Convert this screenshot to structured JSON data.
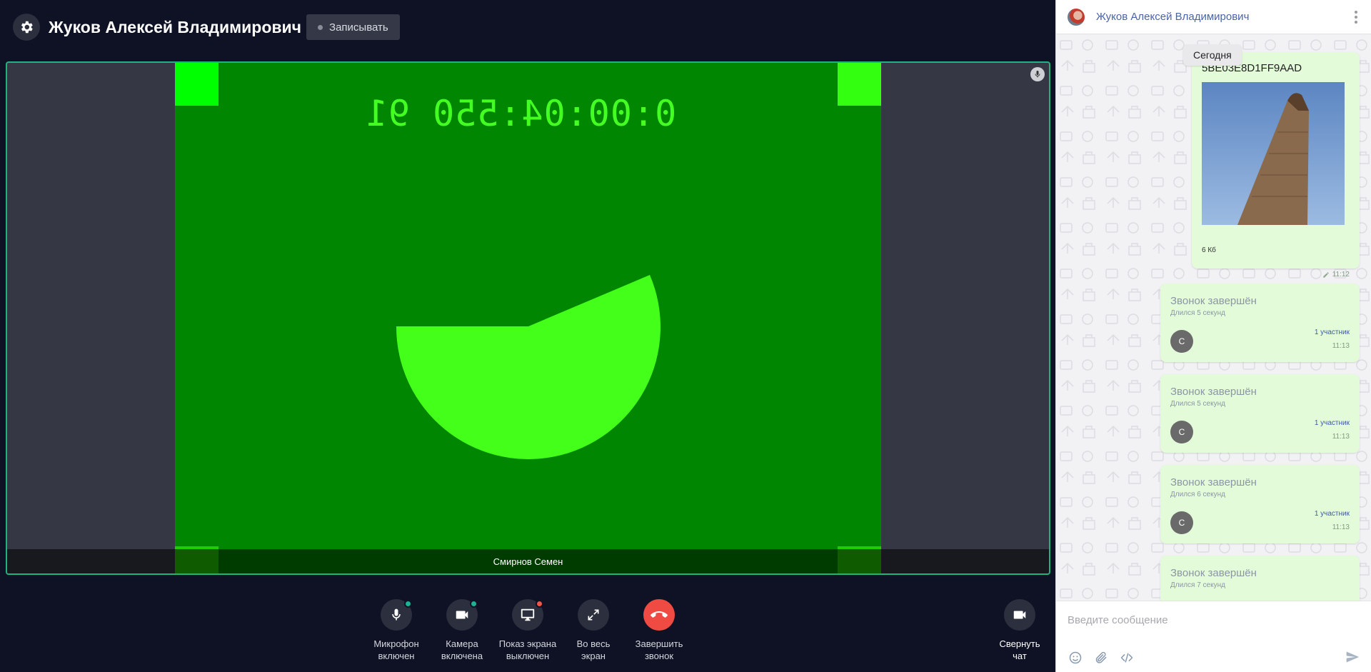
{
  "call": {
    "title": "Жуков Алексей Владимирович",
    "record_label": "Записывать",
    "video": {
      "timecode": "0:00:04:550 91",
      "participant_name": "Смирнов Семен"
    },
    "controls": [
      {
        "label": "Микрофон\nвключен",
        "icon": "microphone-icon",
        "status_color": "#1bb393"
      },
      {
        "label": "Камера\nвключена",
        "icon": "camera-icon",
        "status_color": "#1bb393"
      },
      {
        "label": "Показ экрана\nвыключен",
        "icon": "monitor-icon",
        "status_color": "#f0574a"
      },
      {
        "label": "Во весь\nэкран",
        "icon": "expand-icon"
      },
      {
        "label": "Завершить\nзвонок",
        "icon": "hangup-icon"
      }
    ],
    "collapse_chat_label": "Свернуть\nчат",
    "colors": {
      "accent": "#1fb37f",
      "end_call": "#f04b42",
      "background": "#0e1224"
    }
  },
  "chat": {
    "header_name": "Жуков Алексей Владимирович",
    "date_pill": "Сегодня",
    "file_message": {
      "file_name": "5BE03E8D1FF9AAD",
      "size": "6 Кб",
      "time": "11:12"
    },
    "call_messages": [
      {
        "title": "Звонок завершён",
        "duration": "Длился 5 секунд",
        "avatar": "С",
        "participants": "1 участник",
        "time": "11:13"
      },
      {
        "title": "Звонок завершён",
        "duration": "Длился 5 секунд",
        "avatar": "С",
        "participants": "1 участник",
        "time": "11:13"
      },
      {
        "title": "Звонок завершён",
        "duration": "Длился 6 секунд",
        "avatar": "С",
        "participants": "1 участник",
        "time": "11:13"
      },
      {
        "title": "Звонок завершён",
        "duration": "Длился 7 секунд"
      }
    ],
    "input_placeholder": "Введите сообщение"
  }
}
